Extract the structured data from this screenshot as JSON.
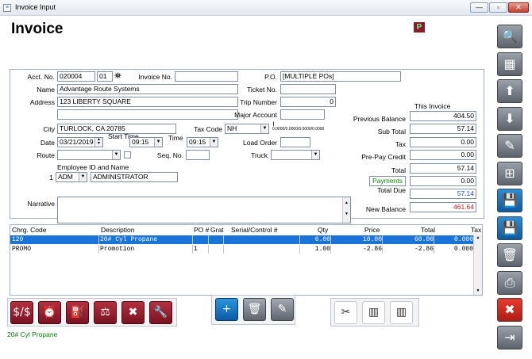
{
  "window": {
    "title": "Invoice Input",
    "min": "—",
    "max": "▫",
    "close": "✕"
  },
  "page_title": "Invoice",
  "badge": "P",
  "form": {
    "acct_no_label": "Acct. No.",
    "acct_no": "020004",
    "acct_sub": "01",
    "invoice_no_label": "Invoice No.",
    "invoice_no": "",
    "po_label": "P.O.",
    "po": "[MULTIPLE POs]",
    "name_label": "Name",
    "name": "Advantage Route Systems",
    "ticket_no_label": "Ticket No.",
    "ticket_no": "",
    "address_label": "Address",
    "address": "123 LIBERTY SQUARE",
    "address2": "",
    "trip_number_label": "Trip Number",
    "trip_number": "0",
    "major_account_label": "Major Account",
    "major_account": "",
    "city_label": "City",
    "city": "TURLOCK, CA  20785",
    "tax_code_label": "Tax Code",
    "tax_code": "NH",
    "tax_rates": "0.0000/0.0000/0.0000/0.0000",
    "date_label": "Date",
    "date": "03/21/2019",
    "start_time_label": "Start Time",
    "start_time": "09:15",
    "time_label": "Time",
    "time": "09:15",
    "load_order_label": "Load Order",
    "load_order": "",
    "route_label": "Route",
    "route": "",
    "seq_no_label": "Seq. No.",
    "seq_no": "",
    "truck_label": "Truck",
    "truck": "",
    "employee_label": "Employee ID and Name",
    "employee_index": "1",
    "employee_id": "ADM",
    "employee_name": "ADMINISTRATOR",
    "narrative_label": "Narrative",
    "narrative": ""
  },
  "totals": {
    "this_invoice_label": "This Invoice",
    "previous_balance_label": "Previous Balance",
    "previous_balance": "404.50",
    "sub_total_label": "Sub Total",
    "sub_total": "57.14",
    "tax_label": "Tax",
    "tax": "0.00",
    "prepay_credit_label": "Pre-Pay Credit",
    "prepay_credit": "0.00",
    "total_label": "Total",
    "total": "57.14",
    "payments_label": "Payments",
    "payments": "0.00",
    "total_due_label": "Total Due",
    "total_due": "57.14",
    "new_balance_label": "New Balance",
    "new_balance": "461.64",
    "colors": {
      "total_due": "#1a4fd0",
      "new_balance": "#c81e1e",
      "payments": "#0a8a0a"
    }
  },
  "grid": {
    "headers": [
      "Chrg. Code",
      "Description",
      "PO #",
      "Grat",
      "Serial/Control #",
      "Qty",
      "Price",
      "Total",
      "Tax"
    ],
    "rows": [
      {
        "code": "120",
        "desc": "20# Cyl Propane",
        "po": "",
        "grat": "",
        "serial": "",
        "qty": "6.00",
        "price": "10.00",
        "total": "60.00",
        "tax": "0.000",
        "selected": true
      },
      {
        "code": "PROMO",
        "desc": "Promotion",
        "po": "1",
        "grat": "",
        "serial": "",
        "qty": "1.00",
        "price": "-2.86",
        "total": "-2.86",
        "tax": "0.000",
        "selected": false
      }
    ]
  },
  "toolbar_left": [
    {
      "name": "currency-charge-icon",
      "glyph": "$/$"
    },
    {
      "name": "alarm-clock-icon",
      "glyph": "⏰"
    },
    {
      "name": "propane-tanks-icon",
      "glyph": "⛽"
    },
    {
      "name": "scale-icon",
      "glyph": "⚖"
    },
    {
      "name": "tools-icon",
      "glyph": "✖"
    },
    {
      "name": "wrench-plug-icon",
      "glyph": "🔧"
    }
  ],
  "toolbar_mid": [
    {
      "name": "add-line-icon",
      "glyph": "+"
    },
    {
      "name": "delete-line-icon",
      "glyph": "🗑"
    },
    {
      "name": "edit-line-icon",
      "glyph": "✎"
    }
  ],
  "toolbar_right": [
    {
      "name": "cut-ticket-icon",
      "glyph": "✂"
    },
    {
      "name": "barcode-icon",
      "glyph": "▥"
    },
    {
      "name": "barcode-remove-icon",
      "glyph": "▥"
    }
  ],
  "sidebar": [
    {
      "name": "search-icon",
      "glyph": "🔍",
      "style": "grey"
    },
    {
      "name": "grid-list-icon",
      "glyph": "▦",
      "style": "grey"
    },
    {
      "name": "arrow-up-icon",
      "glyph": "⬆",
      "style": "grey"
    },
    {
      "name": "arrow-down-icon",
      "glyph": "⬇",
      "style": "grey"
    },
    {
      "name": "pencil-icon",
      "glyph": "✎",
      "style": "grey"
    },
    {
      "name": "new-document-icon",
      "glyph": "⊞",
      "style": "grey"
    },
    {
      "name": "save-new-icon",
      "glyph": "💾",
      "style": "blue"
    },
    {
      "name": "save-icon",
      "glyph": "💾",
      "style": "blue"
    },
    {
      "name": "trash-icon",
      "glyph": "🗑",
      "style": "grey"
    },
    {
      "name": "print-icon",
      "glyph": "⎙",
      "style": "grey"
    },
    {
      "name": "cancel-icon",
      "glyph": "✖",
      "style": "red"
    },
    {
      "name": "exit-icon",
      "glyph": "⇥",
      "style": "grey"
    }
  ],
  "status_text": "20# Cyl Propane"
}
